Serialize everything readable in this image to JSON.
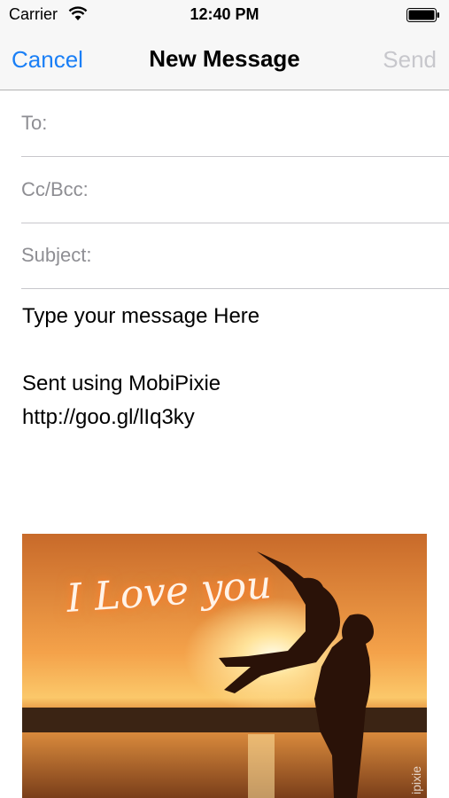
{
  "status_bar": {
    "carrier": "Carrier",
    "time": "12:40 PM",
    "wifi_icon": "wifi-icon",
    "battery_icon": "battery-icon"
  },
  "nav": {
    "cancel_label": "Cancel",
    "title": "New Message",
    "send_label": "Send",
    "accent_color": "#1a7ff6",
    "disabled_color": "#c7c7cc"
  },
  "fields": {
    "to_label": "To:",
    "to_value": "",
    "cc_label": "Cc/Bcc:",
    "cc_value": "",
    "subject_label": "Subject:",
    "subject_value": ""
  },
  "body": {
    "line1": "Type your message Here",
    "line2": "Sent using MobiPixie",
    "line3": "http://goo.gl/lIq3ky"
  },
  "attachment": {
    "overlay_text": "I Love you",
    "watermark": "ipixie"
  }
}
